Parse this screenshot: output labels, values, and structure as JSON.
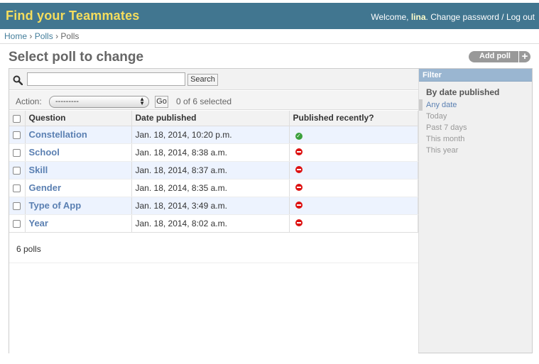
{
  "header": {
    "branding": "Find your Teammates",
    "welcome": "Welcome,",
    "username": "lina",
    "change_password": "Change password",
    "sep": "/",
    "logout": "Log out"
  },
  "breadcrumbs": [
    "Home",
    "Polls",
    "Polls"
  ],
  "page_title": "Select poll to change",
  "add_button": "Add poll",
  "search": {
    "value": "",
    "button": "Search"
  },
  "actions": {
    "label": "Action:",
    "selected_option": "---------",
    "go": "Go",
    "count": "0 of 6 selected"
  },
  "table": {
    "columns": [
      "Question",
      "Date published",
      "Published recently?"
    ],
    "rows": [
      {
        "question": "Constellation",
        "date": "Jan. 18, 2014, 10:20 p.m.",
        "recent": true
      },
      {
        "question": "School",
        "date": "Jan. 18, 2014, 8:38 a.m.",
        "recent": false
      },
      {
        "question": "Skill",
        "date": "Jan. 18, 2014, 8:37 a.m.",
        "recent": false
      },
      {
        "question": "Gender",
        "date": "Jan. 18, 2014, 8:35 a.m.",
        "recent": false
      },
      {
        "question": "Type of App",
        "date": "Jan. 18, 2014, 3:49 a.m.",
        "recent": false
      },
      {
        "question": "Year",
        "date": "Jan. 18, 2014, 8:02 a.m.",
        "recent": false
      }
    ]
  },
  "paginator": "6 polls",
  "filter": {
    "header": "Filter",
    "title": "By date published",
    "options": [
      "Any date",
      "Today",
      "Past 7 days",
      "This month",
      "This year"
    ],
    "selected_index": 0
  },
  "colors": {
    "header_bg": "#417690",
    "branding": "#f5dd5d",
    "link": "#5b80b2",
    "row_alt": "#edf3fe",
    "yes": "#3ca03c",
    "no": "#dd1111"
  }
}
